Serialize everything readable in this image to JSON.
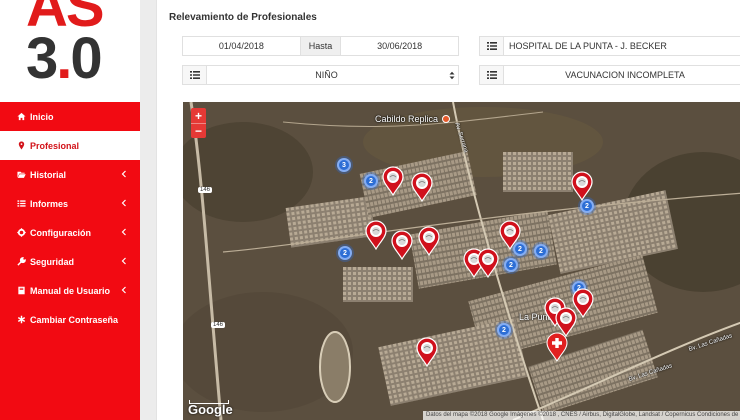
{
  "logo": {
    "line1": "AS",
    "line2_a": "3",
    "line2_dot": ".",
    "line2_b": "0"
  },
  "sidebar": {
    "items": [
      {
        "label": "Inicio",
        "icon": "home-icon",
        "active": false,
        "has_caret": false
      },
      {
        "label": "Profesional",
        "icon": "map-marker-icon",
        "active": true,
        "has_caret": false
      },
      {
        "label": "Historial",
        "icon": "folder-open-icon",
        "active": false,
        "has_caret": true
      },
      {
        "label": "Informes",
        "icon": "list-icon",
        "active": false,
        "has_caret": true
      },
      {
        "label": "Configuración",
        "icon": "cog-icon",
        "active": false,
        "has_caret": true
      },
      {
        "label": "Seguridad",
        "icon": "wrench-icon",
        "active": false,
        "has_caret": true
      },
      {
        "label": "Manual de Usuario",
        "icon": "book-icon",
        "active": false,
        "has_caret": true
      },
      {
        "label": "Cambiar Contraseña",
        "icon": "asterisk-icon",
        "active": false,
        "has_caret": false
      }
    ]
  },
  "panel": {
    "title": "Relevamiento de Profesionales"
  },
  "filters": {
    "date_from": "01/04/2018",
    "hasta_label": "Hasta",
    "date_to": "30/06/2018",
    "hospital": "HOSPITAL DE LA PUNTA - J. BECKER",
    "age_group": "NIÑO",
    "condition": "VACUNACION INCOMPLETA"
  },
  "map": {
    "zoom_in": "+",
    "zoom_out": "−",
    "place_labels": {
      "cabildo": "Cabildo Replica",
      "la_punta": "La Punta",
      "road_146_a": "146",
      "road_146_b": "146",
      "road_serrana": "Av. Serrana",
      "road_canadas_1": "Bv. Las Cañadas",
      "road_canadas_2": "Bv. Las Cañadas"
    },
    "google": "Google",
    "attribution": "Datos del mapa ©2018 Google Imágenes ©2018 , CNES / Airbus, DigitalGlobe, Landsat / Copernicus   Condiciones de uso",
    "clusters": [
      "3",
      "2",
      "2",
      "2",
      "2",
      "2",
      "2",
      "2",
      "2"
    ]
  },
  "colors": {
    "brand_red": "#f20a12",
    "cluster_blue": "#2d6ed5",
    "pin_red": "#d0101c"
  }
}
